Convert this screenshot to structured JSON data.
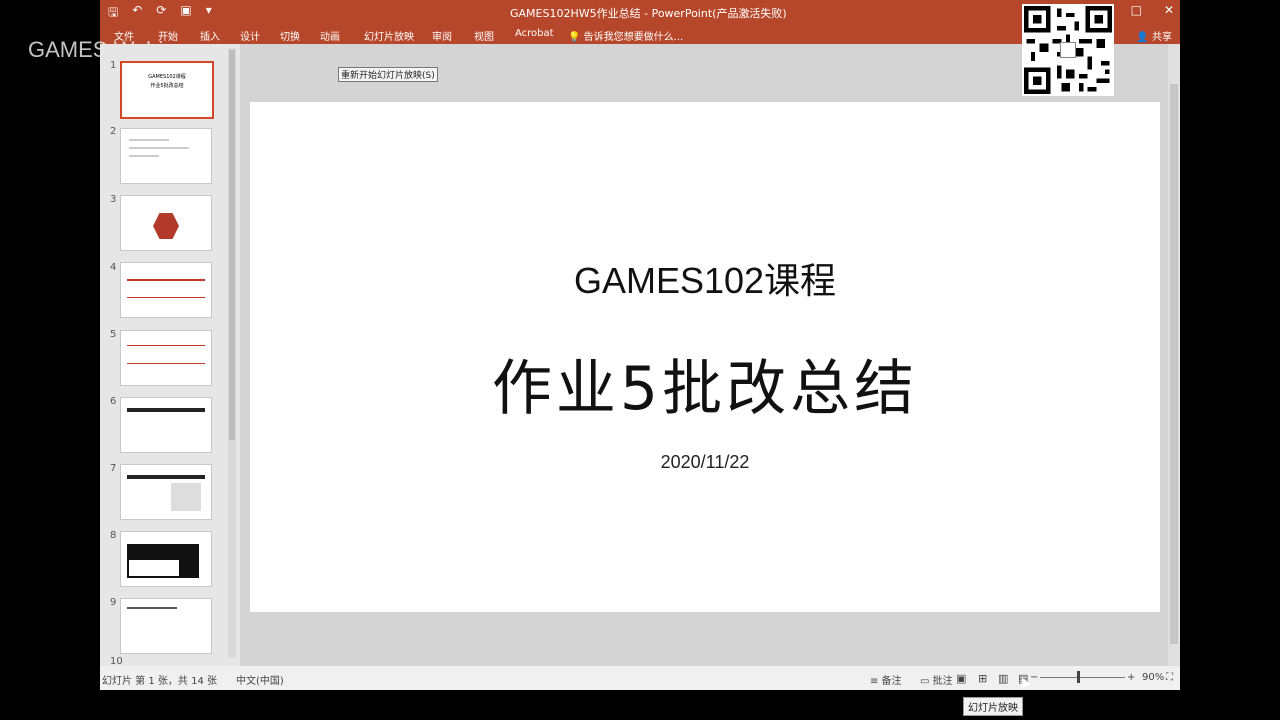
{
  "window": {
    "title": "GAMES102HW5作业总结 - PowerPoint(产品激活失败)",
    "buttons": [
      "?",
      "—",
      "□",
      "✕"
    ]
  },
  "quick_access": {
    "save": "🖫",
    "undo": "↶",
    "redo": "⟳",
    "present": "▣",
    "more": "▾"
  },
  "ribbon": {
    "tabs": [
      "文件",
      "开始",
      "插入",
      "设计",
      "切换",
      "动画",
      "幻灯片放映",
      "审阅",
      "视图",
      "Acrobat"
    ],
    "tell_me": "告诉我您想要做什么...",
    "share": "共享"
  },
  "tooltip": "重新开始幻灯片放映(S)",
  "watermark": "GAMES Webinar",
  "thumbnails": [
    {
      "num": "1",
      "text": "GAMES102课程\n作业5批改总结"
    },
    {
      "num": "2",
      "text": ""
    },
    {
      "num": "3",
      "text": ""
    },
    {
      "num": "4",
      "text": ""
    },
    {
      "num": "5",
      "text": ""
    },
    {
      "num": "6",
      "text": ""
    },
    {
      "num": "7",
      "text": ""
    },
    {
      "num": "8",
      "text": ""
    },
    {
      "num": "9",
      "text": ""
    },
    {
      "num": "10",
      "text": ""
    }
  ],
  "slide": {
    "course": "GAMES102课程",
    "title": "作业5批改总结",
    "date": "2020/11/22"
  },
  "statusbar": {
    "slide_info": "幻灯片 第 1 张，共 14 张",
    "language": "中文(中国)",
    "notes": "≡ 备注",
    "comments": "▭ 批注",
    "zoom": "90%"
  },
  "slideshow_tooltip": "幻灯片放映",
  "colors": {
    "accent": "#b7472a"
  }
}
